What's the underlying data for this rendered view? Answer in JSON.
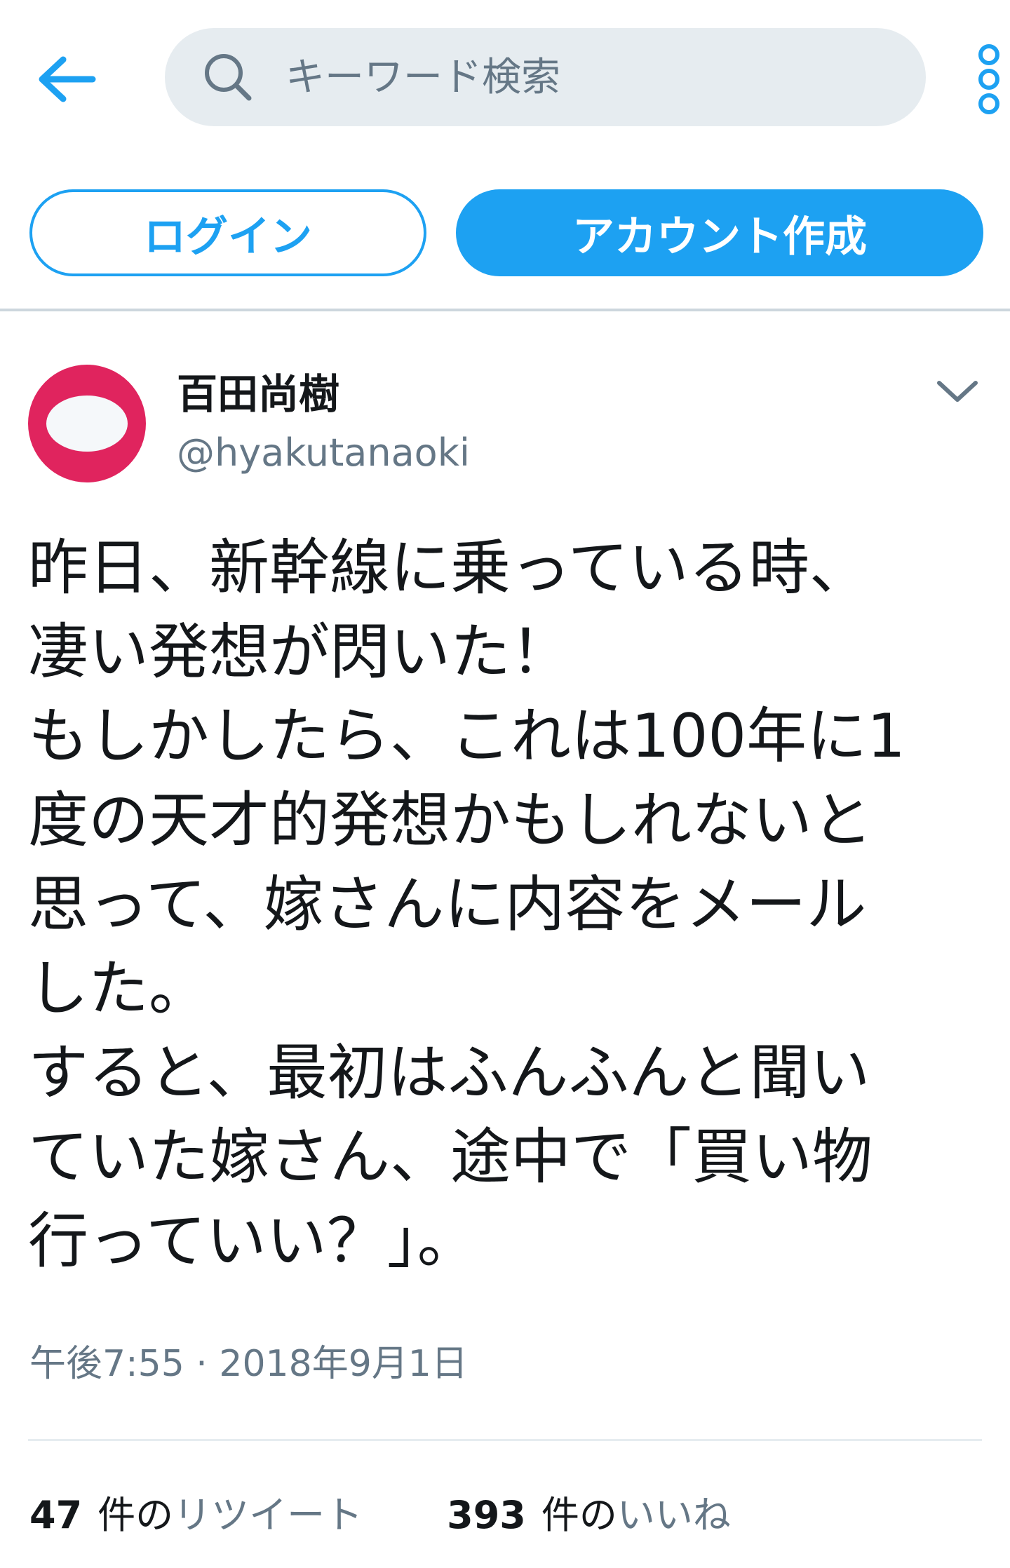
{
  "colors": {
    "accent": "#1da1f2",
    "text_primary": "#14171a",
    "text_secondary": "#657786",
    "search_bg": "#e6ecf0",
    "avatar_bg": "#e0245e"
  },
  "header": {
    "back_icon": "arrow-left-icon",
    "search": {
      "icon": "search-icon",
      "placeholder": "キーワード検索",
      "value": ""
    },
    "more_icon": "more-vertical-icon"
  },
  "auth": {
    "login_label": "ログイン",
    "signup_label": "アカウント作成"
  },
  "tweet": {
    "author": {
      "display_name": "百田尚樹",
      "username": "@hyakutanaoki"
    },
    "caret_icon": "chevron-down-icon",
    "text": "昨日、新幹線に乗っている時、\n凄い発想が閃いた！\nもしかしたら、これは100年に1\n度の天才的発想かもしれないと\n思って、嫁さんに内容をメール\nした。\nすると、最初はふんふんと聞い\nていた嫁さん、途中で「買い物\n行っていい？」。",
    "timestamp": "午後7:55 · 2018年9月1日",
    "stats": {
      "retweets_count": "47",
      "retweets_unit": "件の",
      "retweets_label": "リツイート",
      "likes_count": "393",
      "likes_unit": "件の",
      "likes_label": "いいね"
    }
  }
}
